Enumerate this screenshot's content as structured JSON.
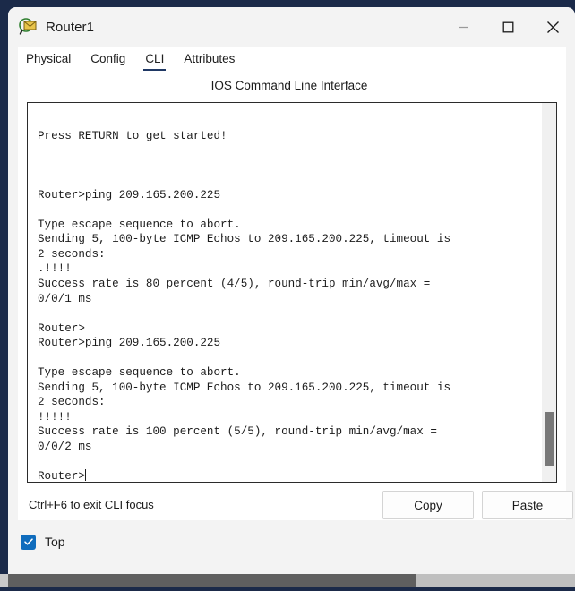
{
  "window": {
    "title": "Router1",
    "icon": "router-magnifier-icon",
    "controls": {
      "minimize": "minimize-icon",
      "maximize": "maximize-icon",
      "close": "close-icon"
    }
  },
  "tabs": [
    {
      "label": "Physical",
      "active": false
    },
    {
      "label": "Config",
      "active": false
    },
    {
      "label": "CLI",
      "active": true
    },
    {
      "label": "Attributes",
      "active": false
    }
  ],
  "panel": {
    "heading": "IOS Command Line Interface"
  },
  "terminal": {
    "text": "\nPress RETURN to get started!\n\n\n\nRouter>ping 209.165.200.225\n\nType escape sequence to abort.\nSending 5, 100-byte ICMP Echos to 209.165.200.225, timeout is\n2 seconds:\n.!!!!\nSuccess rate is 80 percent (4/5), round-trip min/avg/max =\n0/0/1 ms\n\nRouter>\nRouter>ping 209.165.200.225\n\nType escape sequence to abort.\nSending 5, 100-byte ICMP Echos to 209.165.200.225, timeout is\n2 seconds:\n!!!!!\nSuccess rate is 100 percent (5/5), round-trip min/avg/max =\n0/0/2 ms\n\n",
    "prompt": "Router>",
    "lines": [
      "",
      "Press RETURN to get started!",
      "",
      "",
      "",
      "Router>ping 209.165.200.225",
      "",
      "Type escape sequence to abort.",
      "Sending 5, 100-byte ICMP Echos to 209.165.200.225, timeout is",
      "2 seconds:",
      ".!!!!",
      "Success rate is 80 percent (4/5), round-trip min/avg/max =",
      "0/0/1 ms",
      "",
      "Router>",
      "Router>ping 209.165.200.225",
      "",
      "Type escape sequence to abort.",
      "Sending 5, 100-byte ICMP Echos to 209.165.200.225, timeout is",
      "2 seconds:",
      "!!!!!",
      "Success rate is 100 percent (5/5), round-trip min/avg/max =",
      "0/0/2 ms",
      "",
      "Router>"
    ]
  },
  "footer": {
    "hint": "Ctrl+F6 to exit CLI focus",
    "copy_label": "Copy",
    "paste_label": "Paste"
  },
  "bottom": {
    "top_checkbox_label": "Top",
    "top_checkbox_checked": true
  },
  "colors": {
    "desktop": "#1b2a49",
    "window_chrome": "#f3f3f3",
    "panel": "#ffffff",
    "tab_active_underline": "#1f3864",
    "checkbox_accent": "#0f6cbd",
    "scroll_thumb": "#787878",
    "hscroll_thumb": "#5f5f5f"
  }
}
